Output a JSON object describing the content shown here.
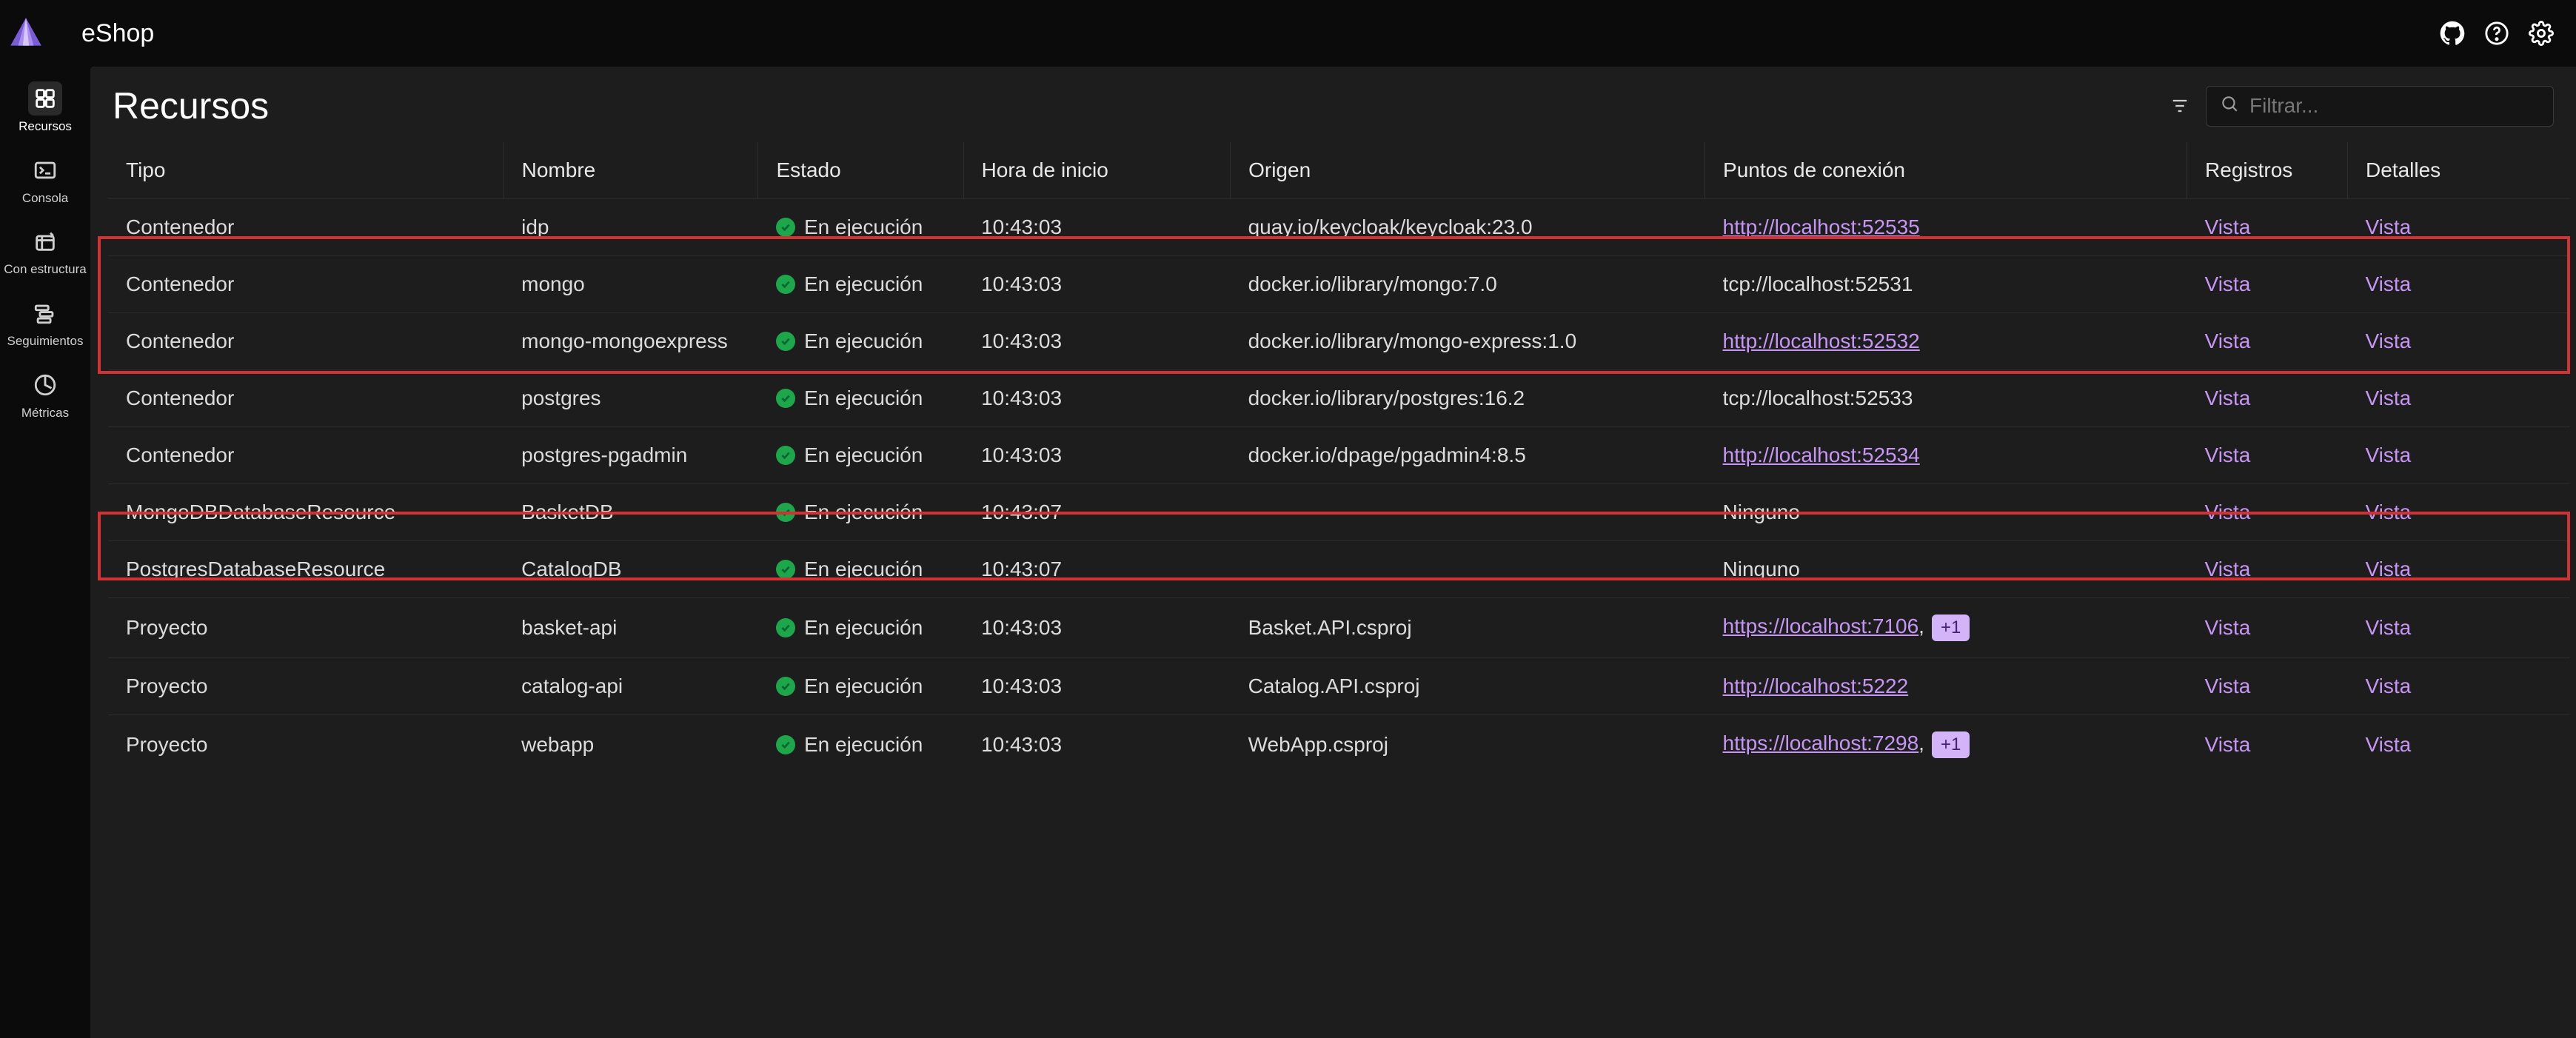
{
  "header": {
    "app_title": "eShop"
  },
  "sidebar": {
    "items": [
      {
        "label": "Recursos"
      },
      {
        "label": "Consola"
      },
      {
        "label": "Con estructura"
      },
      {
        "label": "Seguimientos"
      },
      {
        "label": "Métricas"
      }
    ]
  },
  "page": {
    "title": "Recursos",
    "search_placeholder": "Filtrar..."
  },
  "table": {
    "columns": {
      "tipo": "Tipo",
      "nombre": "Nombre",
      "estado": "Estado",
      "hora": "Hora de inicio",
      "origen": "Origen",
      "puntos": "Puntos de conexión",
      "registros": "Registros",
      "detalles": "Detalles"
    },
    "status_running": "En ejecución",
    "view_label": "Vista",
    "none_label": "Ninguno",
    "plus_badge": "+1",
    "rows": [
      {
        "tipo": "Contenedor",
        "nombre": "idp",
        "hora": "10:43:03",
        "origen": "quay.io/keycloak/keycloak:23.0",
        "endpoint": "http://localhost:52535",
        "endpoint_link": true
      },
      {
        "tipo": "Contenedor",
        "nombre": "mongo",
        "hora": "10:43:03",
        "origen": "docker.io/library/mongo:7.0",
        "endpoint": "tcp://localhost:52531",
        "endpoint_link": false
      },
      {
        "tipo": "Contenedor",
        "nombre": "mongo-mongoexpress",
        "hora": "10:43:03",
        "origen": "docker.io/library/mongo-express:1.0",
        "endpoint": "http://localhost:52532",
        "endpoint_link": true
      },
      {
        "tipo": "Contenedor",
        "nombre": "postgres",
        "hora": "10:43:03",
        "origen": "docker.io/library/postgres:16.2",
        "endpoint": "tcp://localhost:52533",
        "endpoint_link": false
      },
      {
        "tipo": "Contenedor",
        "nombre": "postgres-pgadmin",
        "hora": "10:43:03",
        "origen": "docker.io/dpage/pgadmin4:8.5",
        "endpoint": "http://localhost:52534",
        "endpoint_link": true
      },
      {
        "tipo": "MongoDBDatabaseResource",
        "nombre": "BasketDB",
        "hora": "10:43:07",
        "origen": "",
        "endpoint": "Ninguno",
        "endpoint_link": false
      },
      {
        "tipo": "PostgresDatabaseResource",
        "nombre": "CatalogDB",
        "hora": "10:43:07",
        "origen": "",
        "endpoint": "Ninguno",
        "endpoint_link": false
      },
      {
        "tipo": "Proyecto",
        "nombre": "basket-api",
        "hora": "10:43:03",
        "origen": "Basket.API.csproj",
        "endpoint": "https://localhost:7106",
        "endpoint_link": true,
        "extra_badge": true,
        "comma": true
      },
      {
        "tipo": "Proyecto",
        "nombre": "catalog-api",
        "hora": "10:43:03",
        "origen": "Catalog.API.csproj",
        "endpoint": "http://localhost:5222",
        "endpoint_link": true
      },
      {
        "tipo": "Proyecto",
        "nombre": "webapp",
        "hora": "10:43:03",
        "origen": "WebApp.csproj",
        "endpoint": "https://localhost:7298",
        "endpoint_link": true,
        "extra_badge": true,
        "comma": true
      }
    ]
  }
}
